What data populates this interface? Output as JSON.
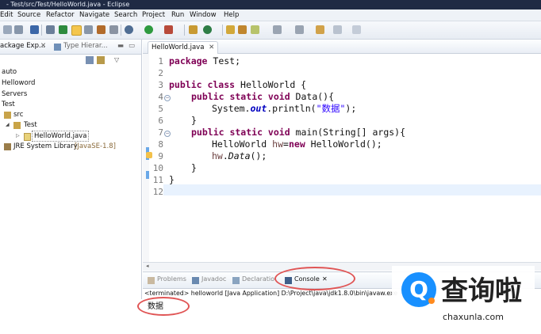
{
  "window": {
    "title": "- Test/src/Test/HelloWorld.java - Eclipse"
  },
  "menu": [
    "Edit",
    "Source",
    "Refactor",
    "Navigate",
    "Search",
    "Project",
    "Run",
    "Window",
    "Help"
  ],
  "left_panel": {
    "tabs": [
      "ackage Exp...",
      "Type Hierar..."
    ],
    "tree": [
      "auto",
      "Helloword",
      "Servers",
      "Test",
      "src",
      "Test",
      "HelloWorld.java",
      "JRE System Library",
      "[JavaSE-1.8]"
    ]
  },
  "editor": {
    "tab": "HelloWorld.java",
    "line_numbers": [
      "1",
      "2",
      "3",
      "4",
      "5",
      "6",
      "7",
      "8",
      "9",
      "10",
      "11",
      "12"
    ]
  },
  "code": {
    "l1_kw": "package",
    "l1_rest": " Test;",
    "l3_kw": "public class",
    "l3_rest": " HelloWorld {",
    "l4_kw": "public static void",
    "l4_rest": " Data(){",
    "l5_a": "System.",
    "l5_b": "out",
    "l5_c": ".println(",
    "l5_str": "\"数据\"",
    "l5_d": ");",
    "l6": "}",
    "l7_kw": "public static void",
    "l7_rest": " main(String[] args){",
    "l8_a": "HelloWorld ",
    "l8_var": "hw",
    "l8_b": "=",
    "l8_kw": "new",
    "l8_c": " HelloWorld();",
    "l9_var": "hw",
    "l9_dot": ".",
    "l9_m": "Data",
    "l9_end": "();",
    "l10": "}",
    "l11": "}"
  },
  "bottom_panel": {
    "tabs": [
      "Problems",
      "Javadoc",
      "Declaratio",
      "Console"
    ],
    "console_header": "<terminated> helloworld [Java Application] D:\\Project\\java\\jdk1.8.0\\bin\\javaw.exe",
    "output": "数据"
  },
  "watermark": {
    "glyph": "Q",
    "cn": "查询啦",
    "url": "chaxunla.com"
  },
  "colors": {
    "keyword": "#7f0055",
    "string": "#2a00ff",
    "field": "#0000c0",
    "annotation_red": "#e05555",
    "watermark_blue": "#1890ff",
    "watermark_orange": "#ff8a1e"
  }
}
